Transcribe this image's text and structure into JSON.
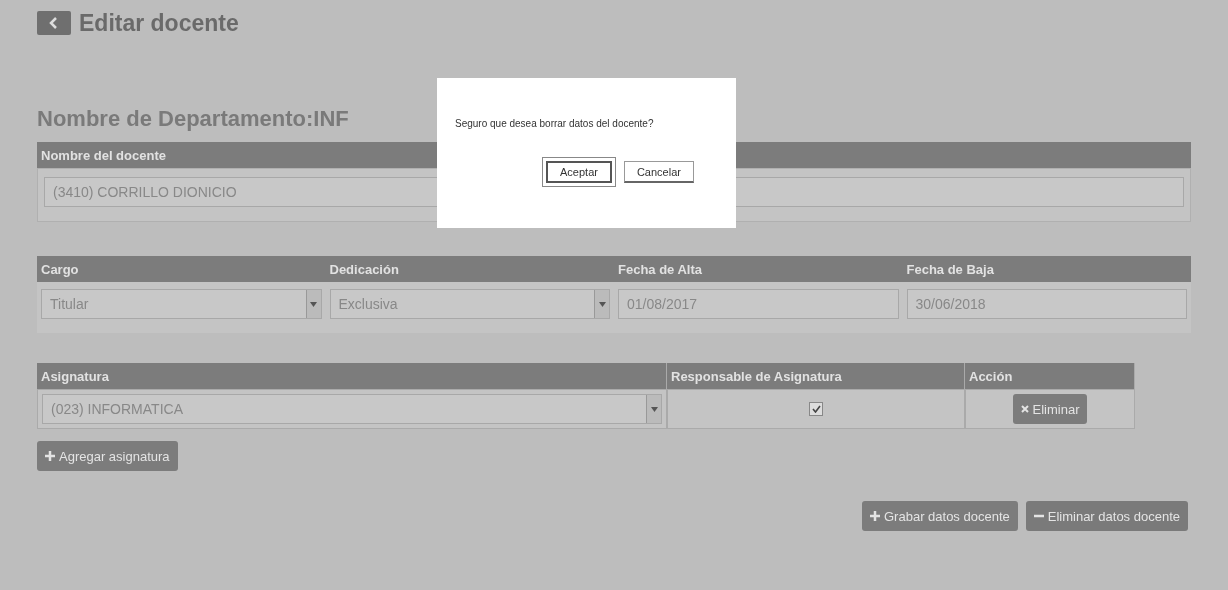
{
  "page": {
    "title": "Editar docente",
    "department_heading": "Nombre de Departamento:INF"
  },
  "docente": {
    "label": "Nombre del docente",
    "value": "(3410) CORRILLO DIONICIO"
  },
  "fields": [
    {
      "label": "Cargo",
      "kind": "select",
      "value": "Titular"
    },
    {
      "label": "Dedicación",
      "kind": "select",
      "value": "Exclusiva"
    },
    {
      "label": "Fecha de Alta",
      "kind": "text",
      "value": "01/08/2017"
    },
    {
      "label": "Fecha de Baja",
      "kind": "text",
      "value": "30/06/2018"
    }
  ],
  "asignaturas": {
    "columns": [
      "Asignatura",
      "Responsable de Asignatura",
      "Acción"
    ],
    "rows": [
      {
        "asignatura": "(023) INFORMATICA",
        "responsable": true,
        "action": "Eliminar"
      }
    ],
    "add_button": "Agregar asignatura"
  },
  "footer_buttons": [
    {
      "label": "Grabar datos docente",
      "kind": "add"
    },
    {
      "label": "Eliminar datos docente",
      "kind": "remove"
    }
  ],
  "dialog": {
    "message": "Seguro que desea borrar datos del docente?",
    "buttons": [
      {
        "label": "Aceptar",
        "focused": true
      },
      {
        "label": "Cancelar",
        "focused": false
      }
    ]
  }
}
